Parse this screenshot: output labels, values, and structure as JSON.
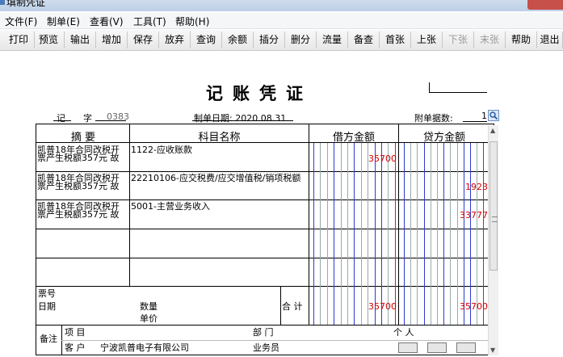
{
  "window": {
    "title": "填制凭证"
  },
  "menu": [
    "文件(F)",
    "制单(E)",
    "查看(V)",
    "工具(T)",
    "帮助(H)"
  ],
  "toolbar": [
    {
      "label": "打印",
      "enabled": true
    },
    {
      "label": "预览",
      "enabled": true
    },
    {
      "label": "输出",
      "enabled": true
    },
    {
      "label": "增加",
      "enabled": true
    },
    {
      "label": "保存",
      "enabled": true
    },
    {
      "label": "放弃",
      "enabled": true
    },
    {
      "label": "查询",
      "enabled": true
    },
    {
      "label": "余额",
      "enabled": true
    },
    {
      "label": "插分",
      "enabled": true
    },
    {
      "label": "删分",
      "enabled": true
    },
    {
      "label": "流量",
      "enabled": true
    },
    {
      "label": "备查",
      "enabled": true
    },
    {
      "label": "首张",
      "enabled": true
    },
    {
      "label": "上张",
      "enabled": true
    },
    {
      "label": "下张",
      "enabled": false
    },
    {
      "label": "末张",
      "enabled": false
    },
    {
      "label": "帮助",
      "enabled": true
    },
    {
      "label": "退出",
      "enabled": true
    }
  ],
  "voucher": {
    "heading": "记账凭证",
    "type": "记",
    "zi_label": "字",
    "number": "0383",
    "date_label": "制单日期:",
    "date": "2020.08.31",
    "attach_label": "附单据数:",
    "attach_count": "1",
    "columns": {
      "summary": "摘 要",
      "account": "科目名称",
      "debit": "借方金额",
      "credit": "贷方金额"
    },
    "entries": [
      {
        "summary_1": "凯普18年合同改税开",
        "summary_2": "票产生税额357元 故",
        "account": "1122-应收账款",
        "debit": "35700",
        "credit": ""
      },
      {
        "summary_1": "凯普18年合同改税开",
        "summary_2": "票产生税额357元 故",
        "account": "22210106-应交税费/应交增值税/销项税额",
        "debit": "",
        "credit": "1923"
      },
      {
        "summary_1": "凯普18年合同改税开",
        "summary_2": "票产生税额357元 故",
        "account": "5001-主营业务收入",
        "debit": "",
        "credit": "33777"
      },
      {
        "summary_1": "",
        "summary_2": "",
        "account": "",
        "debit": "",
        "credit": ""
      },
      {
        "summary_1": "",
        "summary_2": "",
        "account": "",
        "debit": "",
        "credit": ""
      }
    ],
    "footer": {
      "ticket_no_label": "票号",
      "date_label": "日期",
      "qty_label": "数量",
      "price_label": "单价",
      "total_label": "合 计",
      "total_debit": "35700",
      "total_credit": "35700"
    },
    "remarks": {
      "label": "备注",
      "project_label": "项  目",
      "dept_label": "部  门",
      "person_label": "个  人",
      "customer_label": "客  户",
      "customer": "宁波凯普电子有限公司",
      "salesman_label": "业务员"
    }
  }
}
